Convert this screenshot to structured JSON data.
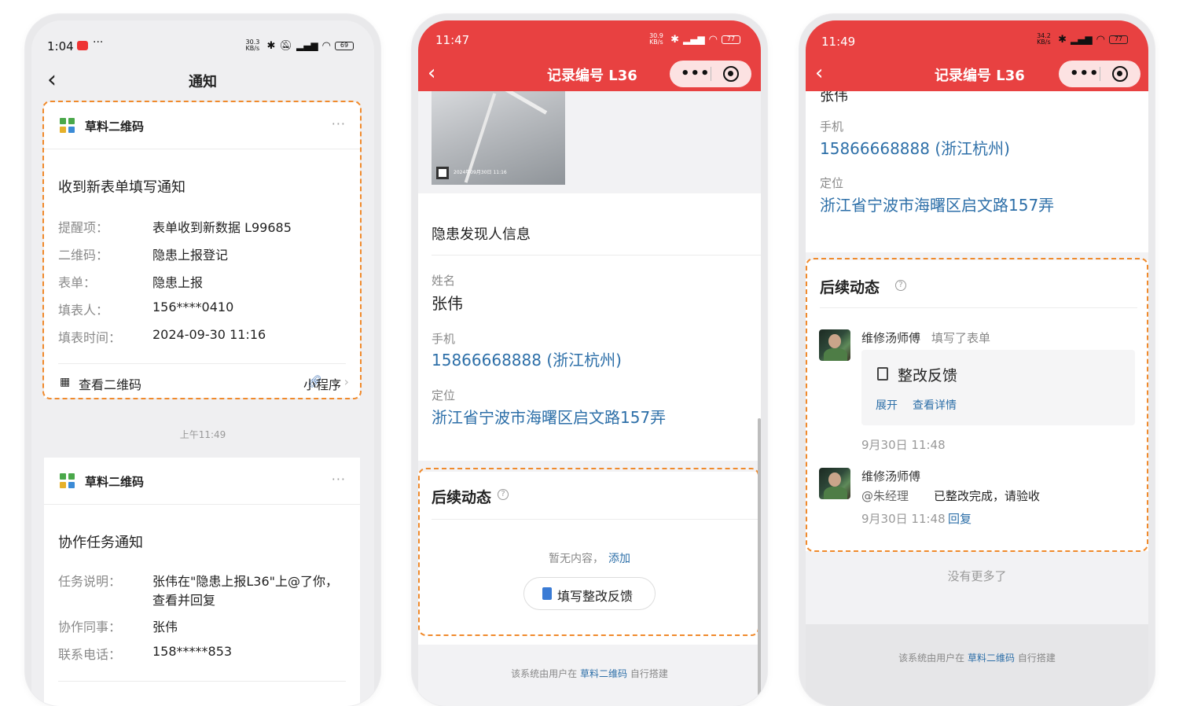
{
  "phone1": {
    "status": {
      "time": "1:04",
      "net": "30.3 KB/s",
      "battery": "69"
    },
    "nav": {
      "back": "‹",
      "title": "通知"
    },
    "card1": {
      "app_name": "草料二维码",
      "more": "···",
      "title": "收到新表单填写通知",
      "rows": [
        {
          "label": "提醒项：",
          "value": "表单收到新数据 L99685"
        },
        {
          "label": "二维码：",
          "value": "隐患上报登记"
        },
        {
          "label": "表单：",
          "value": "隐患上报"
        },
        {
          "label": "填表人：",
          "value": "156****0410"
        },
        {
          "label": "填表时间：",
          "value": "2024-09-30 11:16"
        }
      ],
      "footer_left": "查看二维码",
      "footer_right": "小程序"
    },
    "timestamp": "上午11:49",
    "card2": {
      "app_name": "草料二维码",
      "more": "···",
      "title": "协作任务通知",
      "rows": [
        {
          "label": "任务说明：",
          "value": "张伟在\"隐患上报L36\"上@了你，",
          "value2": "查看并回复"
        },
        {
          "label": "协作同事：",
          "value": "张伟"
        },
        {
          "label": "联系电话：",
          "value": "158*****853"
        }
      ]
    }
  },
  "phone2": {
    "status": {
      "time": "11:47",
      "net": "30.9 KB/s",
      "battery": "77"
    },
    "header": {
      "title": "记录编号 L36"
    },
    "photo_caption": "2024年09月30日 11:16",
    "section_title": "隐患发现人信息",
    "name_label": "姓名",
    "name_value": "张伟",
    "phone_label": "手机",
    "phone_value": "15866668888 (浙江杭州)",
    "location_label": "定位",
    "location_value": "浙江省宁波市海曙区启文路157弄",
    "follow_title": "后续动态",
    "empty_text": "暂无内容，",
    "empty_add": "添加",
    "fill_button": "填写整改反馈",
    "footer_pre": "该系统由用户在",
    "footer_link": "草料二维码",
    "footer_post": "自行搭建"
  },
  "phone3": {
    "status": {
      "time": "11:49",
      "net": "34.2 KB/s",
      "battery": "77"
    },
    "header": {
      "title": "记录编号 L36"
    },
    "cut_text": "张伟",
    "phone_label": "手机",
    "phone_value": "15866668888 (浙江杭州)",
    "location_label": "定位",
    "location_value": "浙江省宁波市海曙区启文路157弄",
    "follow_title": "后续动态",
    "entry1": {
      "user": "维修汤师傅",
      "action": "填写了表单",
      "form_title": "整改反馈",
      "expand": "展开",
      "detail": "查看详情",
      "time": "9月30日 11:48"
    },
    "entry2": {
      "user": "维修汤师傅",
      "mention": "@朱经理",
      "message": "已整改完成，请验收",
      "time": "9月30日 11:48",
      "reply": "回复"
    },
    "no_more": "没有更多了",
    "footer_pre": "该系统由用户在",
    "footer_link": "草料二维码",
    "footer_post": "自行搭建"
  },
  "colors": {
    "accent_red": "#e84141",
    "link_blue": "#2d6fa8",
    "highlight_orange": "#f08a2c"
  }
}
